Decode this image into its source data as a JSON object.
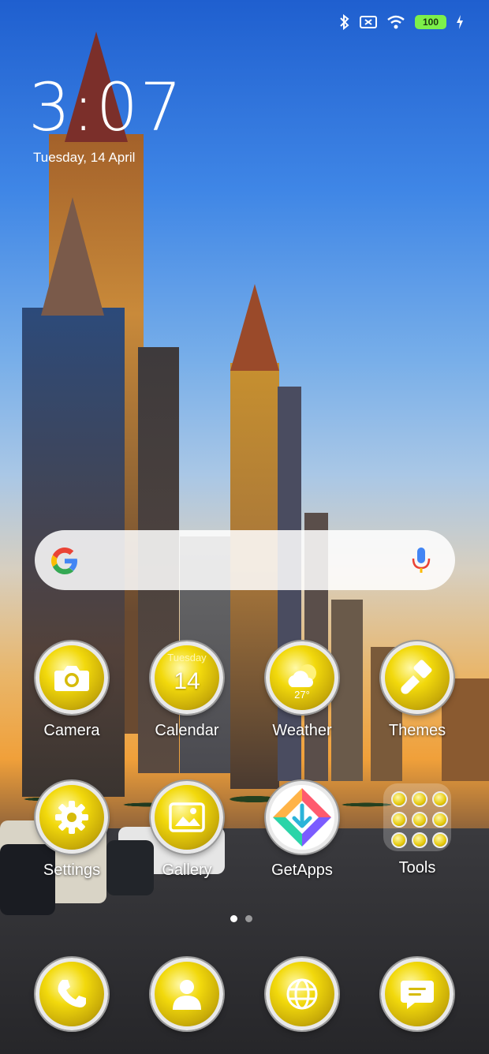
{
  "status_bar": {
    "icons": [
      "bluetooth-icon",
      "no-sim-icon",
      "wifi-icon",
      "battery-icon",
      "charging-icon"
    ],
    "battery_level": "100",
    "battery_color": "#7cf04a"
  },
  "clock": {
    "time": "3:07",
    "date": "Tuesday, 14 April"
  },
  "search_bar": {
    "logo": "google-logo",
    "mic_icon": "mic-icon"
  },
  "apps": [
    {
      "id": "camera",
      "label": "Camera",
      "icon": "camera-icon"
    },
    {
      "id": "calendar",
      "label": "Calendar",
      "icon": "calendar-icon",
      "day_name": "Tuesday",
      "day_number": "14"
    },
    {
      "id": "weather",
      "label": "Weather",
      "icon": "weather-icon",
      "temperature": "27°"
    },
    {
      "id": "themes",
      "label": "Themes",
      "icon": "paintbrush-icon"
    },
    {
      "id": "settings",
      "label": "Settings",
      "icon": "gear-icon"
    },
    {
      "id": "gallery",
      "label": "Gallery",
      "icon": "image-icon"
    },
    {
      "id": "getapps",
      "label": "GetApps",
      "icon": "getapps-icon"
    },
    {
      "id": "tools",
      "label": "Tools",
      "icon": "folder-icon"
    }
  ],
  "page_indicator": {
    "pages": 2,
    "current": 1
  },
  "dock": [
    {
      "id": "phone",
      "icon": "phone-icon"
    },
    {
      "id": "contacts",
      "icon": "contacts-icon"
    },
    {
      "id": "browser",
      "icon": "globe-icon"
    },
    {
      "id": "messages",
      "icon": "message-icon"
    }
  ],
  "colors": {
    "icon_gold": "#f2d90c",
    "icon_rim": "#e9e9e9"
  }
}
